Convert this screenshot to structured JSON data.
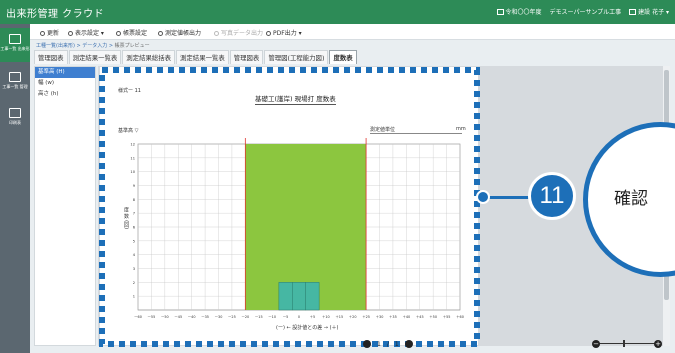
{
  "app": {
    "title": "出来形管理 クラウド"
  },
  "header": {
    "items": [
      "令和〇〇年度",
      "デモスーパーサンプル工事",
      "建設 花子"
    ]
  },
  "rail": {
    "items": [
      {
        "label": "工事一覧\n出来形",
        "icon": "home-icon"
      },
      {
        "label": "工事一覧\n管理",
        "icon": "list-icon"
      },
      {
        "label": "印刷表",
        "icon": "table-icon"
      }
    ]
  },
  "toolbar": {
    "buttons": [
      {
        "label": "更新",
        "icon": "refresh-icon",
        "enabled": true
      },
      {
        "label": "表示設定",
        "icon": "display-icon",
        "enabled": true
      },
      {
        "label": "帳票設定",
        "icon": "settings-icon",
        "enabled": true
      },
      {
        "label": "測定値帳出力",
        "icon": "export-icon",
        "enabled": true
      },
      {
        "label": "写真データ出力",
        "icon": "photo-icon",
        "enabled": false
      },
      {
        "label": "PDF出力",
        "icon": "pdf-icon",
        "enabled": true
      }
    ]
  },
  "breadcrumb": {
    "parts": [
      "工種一覧(出来形)",
      "データ入力"
    ],
    "current": "帳票プレビュー"
  },
  "tabs": [
    "管理図表",
    "測定結果一覧表",
    "測定結果総括表",
    "測定結果一覧表",
    "管理図表",
    "管理図(工程能力図)",
    "度数表"
  ],
  "active_tab_index": 6,
  "list": {
    "items": [
      "基準高 (H)",
      "幅 (w)",
      "高さ (h)"
    ],
    "active_index": 0
  },
  "document": {
    "form_no": "様式ー 11",
    "title": "基礎工(護岸) 現場打 度数表",
    "left_label": "基準高 ▽",
    "measure_label": "測定値単位",
    "unit": "mm",
    "y_axis_label": "度 数 (回)",
    "x_axis_label": "(ー)  ←   設計値との差   →  (＋)",
    "tick_labels": [
      "ー60",
      "ー55",
      "ー50",
      "ー45",
      "ー40",
      "ー35",
      "ー30",
      "ー25",
      "ー20",
      "ー15",
      "ー10",
      "ー5",
      "0",
      "＋5",
      "＋10",
      "＋15",
      "＋20",
      "＋25",
      "＋30",
      "＋35",
      "＋40",
      "＋45",
      "＋50",
      "＋55",
      "＋60"
    ],
    "y_ticks": [
      "12",
      "11",
      "10",
      "9",
      "8",
      "7",
      "6",
      "5",
      "4",
      "3",
      "2",
      "1"
    ]
  },
  "chart_data": {
    "type": "bar",
    "title": "基礎工(護岸) 現場打 度数表",
    "xlabel": "(ー)  ←   設計値との差   →  (＋)",
    "ylabel": "度 数 (回)",
    "categories": [
      "ー5",
      "0",
      "＋5"
    ],
    "values": [
      2,
      2,
      2
    ],
    "ylim": [
      0,
      12
    ],
    "xlim": [
      -60,
      60
    ],
    "green_band": [
      -20,
      25
    ],
    "limit_line_color": "#e0332f",
    "band_color": "#8cc63f",
    "bar_color": "#46b7a3"
  },
  "pager": {
    "current": "1",
    "total": "1",
    "separator": "/"
  },
  "callout": {
    "step": "11",
    "label": "確認"
  },
  "colors": {
    "accent": "#2d8b57",
    "callout": "#1d6fb8",
    "selection": "#3f7fd0"
  }
}
